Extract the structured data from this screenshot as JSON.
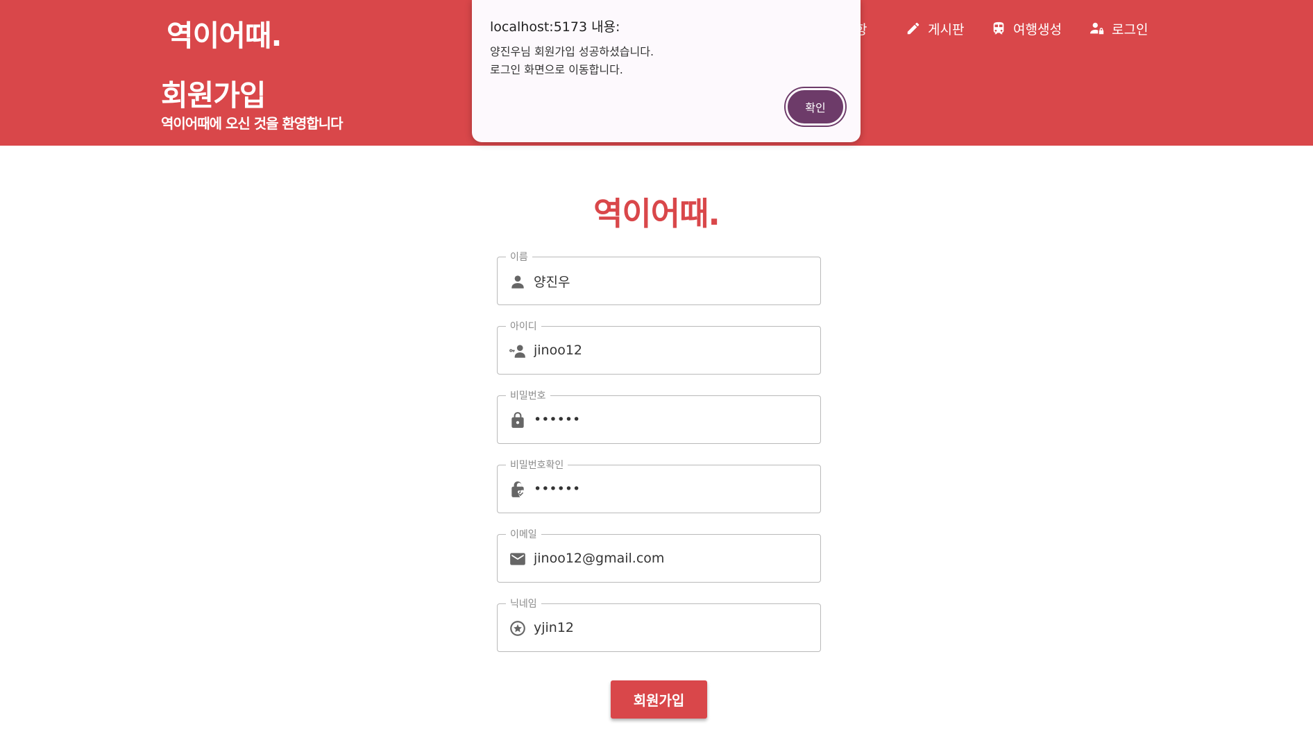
{
  "header": {
    "logo": "역이어때.",
    "title": "회원가입",
    "subtitle": "역이어때에 오신 것을 환영합니다",
    "bg_color": "#d9474a",
    "nav": [
      {
        "label": "항",
        "icon": "notice-icon"
      },
      {
        "label": "게시판",
        "icon": "pencil-icon"
      },
      {
        "label": "여행생성",
        "icon": "train-icon"
      },
      {
        "label": "로그인",
        "icon": "user-lock-icon"
      }
    ]
  },
  "dialog": {
    "title": "localhost:5173 내용:",
    "message_line1": "양진우님 회원가입 성공하셨습니다.",
    "message_line2": "로그인 화면으로 이동합니다.",
    "ok_label": "확인",
    "button_color": "#6d3b69"
  },
  "form": {
    "brand": "역이어때.",
    "fields": [
      {
        "label": "이름",
        "value": "양진우",
        "icon": "person-icon",
        "type": "text"
      },
      {
        "label": "아이디",
        "value": "jinoo12",
        "icon": "person-key-icon",
        "type": "text"
      },
      {
        "label": "비밀번호",
        "value": "123456",
        "icon": "lock-icon",
        "type": "password"
      },
      {
        "label": "비밀번호확인",
        "value": "123456",
        "icon": "lock-check-icon",
        "type": "password"
      },
      {
        "label": "이메일",
        "value": "jinoo12@gmail.com",
        "icon": "mail-icon",
        "type": "text"
      },
      {
        "label": "닉네임",
        "value": "yjin12",
        "icon": "star-circle-icon",
        "type": "text"
      }
    ],
    "submit_label": "회원가입",
    "accent_color": "#d9474a"
  }
}
